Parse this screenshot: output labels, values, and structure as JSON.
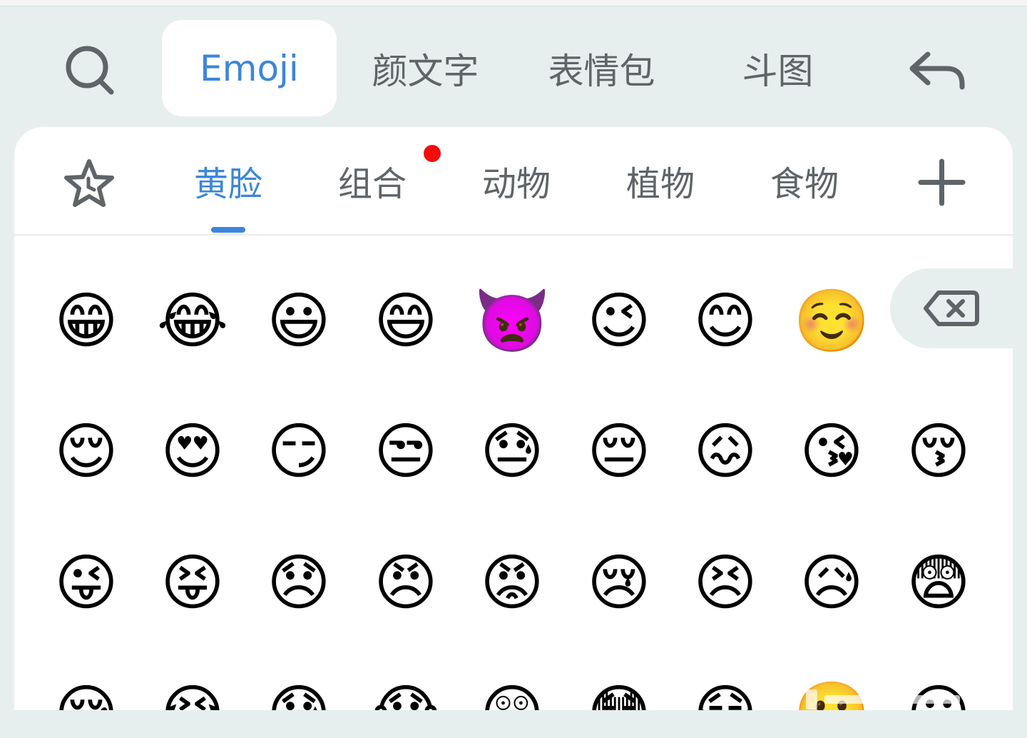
{
  "top_tabs": [
    {
      "label": "Emoji",
      "active": true
    },
    {
      "label": "颜文字",
      "active": false
    },
    {
      "label": "表情包",
      "active": false
    },
    {
      "label": "斗图",
      "active": false
    }
  ],
  "icons": {
    "search": "search-icon",
    "back": "back-arrow-icon",
    "favorites": "star-clock-icon",
    "add": "plus-icon",
    "delete": "backspace-icon"
  },
  "category_tabs": [
    {
      "label": "黄脸",
      "active": true
    },
    {
      "label": "组合",
      "active": false,
      "badge": true
    },
    {
      "label": "动物",
      "active": false
    },
    {
      "label": "植物",
      "active": false
    },
    {
      "label": "食物",
      "active": false
    }
  ],
  "colors": {
    "accent": "#3c86d9",
    "badge": "#f30c0c",
    "background": "#e6efed"
  },
  "emoji_rows": [
    [
      "😁",
      "😂",
      "😃",
      "😄",
      "👿",
      "😉",
      "😊",
      "☺️"
    ],
    [
      "😌",
      "😍",
      "😏",
      "😒",
      "😓",
      "😔",
      "😖",
      "😘",
      "😚"
    ],
    [
      "😜",
      "😝",
      "😞",
      "😠",
      "😡",
      "😢",
      "😣",
      "😥",
      "😨"
    ],
    [
      "😪",
      "😭",
      "😰",
      "😱",
      "😲",
      "😳",
      "😷",
      "🙂",
      "😀"
    ]
  ]
}
